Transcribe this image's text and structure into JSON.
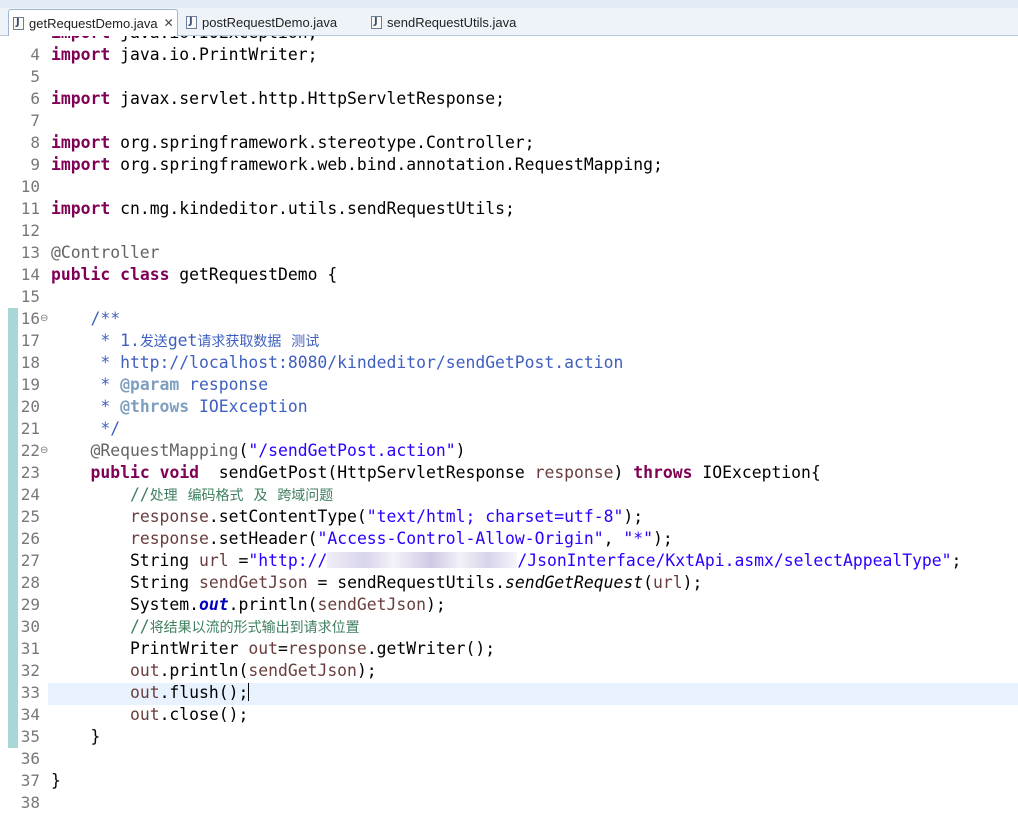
{
  "tabs": [
    {
      "label": "getRequestDemo.java",
      "active": true,
      "close": "✕"
    },
    {
      "label": "postRequestDemo.java",
      "active": false
    },
    {
      "label": "sendRequestUtils.java",
      "active": false
    }
  ],
  "editor": {
    "partial_top_line": "import java.io.IOException;",
    "lines": [
      {
        "n": "4",
        "text": "import java.io.PrintWriter;"
      },
      {
        "n": "5",
        "text": ""
      },
      {
        "n": "6",
        "text": "import javax.servlet.http.HttpServletResponse;"
      },
      {
        "n": "7",
        "text": ""
      },
      {
        "n": "8",
        "text": "import org.springframework.stereotype.Controller;"
      },
      {
        "n": "9",
        "text": "import org.springframework.web.bind.annotation.RequestMapping;"
      },
      {
        "n": "10",
        "text": ""
      },
      {
        "n": "11",
        "text": "import cn.mg.kindeditor.utils.sendRequestUtils;"
      },
      {
        "n": "12",
        "text": ""
      },
      {
        "n": "13",
        "text": "@Controller"
      },
      {
        "n": "14",
        "text": "public class getRequestDemo {"
      },
      {
        "n": "15",
        "text": ""
      },
      {
        "n": "16",
        "text": "    /**"
      },
      {
        "n": "17",
        "text": "     * 1.发送get请求获取数据 测试"
      },
      {
        "n": "18",
        "text": "     * http://localhost:8080/kindeditor/sendGetPost.action"
      },
      {
        "n": "19",
        "text": "     * @param response"
      },
      {
        "n": "20",
        "text": "     * @throws IOException"
      },
      {
        "n": "21",
        "text": "     */"
      },
      {
        "n": "22",
        "text": "    @RequestMapping(\"/sendGetPost.action\")"
      },
      {
        "n": "23",
        "text": "    public void  sendGetPost(HttpServletResponse response) throws IOException{"
      },
      {
        "n": "24",
        "text": "        //处理 编码格式 及 跨域问题"
      },
      {
        "n": "25",
        "text": "        response.setContentType(\"text/html; charset=utf-8\");"
      },
      {
        "n": "26",
        "text": "        response.setHeader(\"Access-Control-Allow-Origin\", \"*\");"
      },
      {
        "n": "27",
        "text": "        String url =\"http://[redacted]/JsonInterface/KxtApi.asmx/selectAppealType\";"
      },
      {
        "n": "28",
        "text": "        String sendGetJson = sendRequestUtils.sendGetRequest(url);"
      },
      {
        "n": "29",
        "text": "        System.out.println(sendGetJson);"
      },
      {
        "n": "30",
        "text": "        //将结果以流的形式输出到请求位置"
      },
      {
        "n": "31",
        "text": "        PrintWriter out=response.getWriter();"
      },
      {
        "n": "32",
        "text": "        out.println(sendGetJson);"
      },
      {
        "n": "33",
        "text": "        out.flush();"
      },
      {
        "n": "34",
        "text": "        out.close();"
      },
      {
        "n": "35",
        "text": "    }"
      },
      {
        "n": "36",
        "text": ""
      },
      {
        "n": "37",
        "text": "}"
      },
      {
        "n": "38",
        "text": ""
      }
    ],
    "fold_markers": [
      "16",
      "22"
    ],
    "change_markers": [
      "16",
      "17",
      "18",
      "19",
      "20",
      "21",
      "22",
      "23",
      "24",
      "25",
      "26",
      "27",
      "28",
      "29",
      "30",
      "31",
      "32",
      "33",
      "34",
      "35"
    ],
    "current_line": "33",
    "colors": {
      "keyword": "#7f0055",
      "string": "#2a00ff",
      "javadoc": "#3f5fbf",
      "comment": "#3f7f5f",
      "annotation": "#646464",
      "variable": "#6a3e3e",
      "current_line_bg": "#e8f2fe",
      "change_marker": "#a9d6d6"
    }
  }
}
